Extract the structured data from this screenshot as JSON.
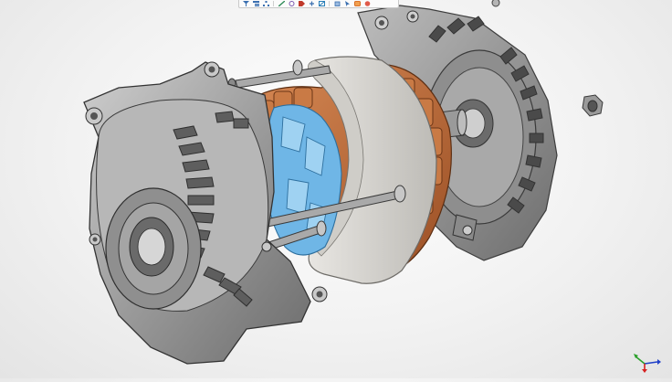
{
  "toolbar": {
    "buttons": [
      {
        "icon": "filter-icon",
        "color": "#3a6fb0"
      },
      {
        "icon": "tree-view-icon",
        "color": "#3a6fb0"
      },
      {
        "icon": "hierarchy-icon",
        "color": "#3a6fb0"
      },
      {
        "icon": "measure-icon",
        "color": "#2e8b57"
      },
      {
        "icon": "clip-icon",
        "color": "#7a58b0"
      },
      {
        "icon": "tag-icon",
        "color": "#c0392b"
      },
      {
        "icon": "explode-icon",
        "color": "#3a6fb0"
      },
      {
        "icon": "section-icon",
        "color": "#2a7fb8"
      },
      {
        "icon": "view-cube-icon",
        "color": "#3a6fb0"
      },
      {
        "icon": "select-icon",
        "color": "#3a6fb0"
      },
      {
        "icon": "display-mode-icon",
        "color": "#d35400"
      },
      {
        "icon": "shaded-sphere-icon",
        "color": "#c0392b"
      }
    ]
  },
  "model": {
    "colors": {
      "housing": "#9a9a9a",
      "housing_dark": "#555555",
      "stator_core": "#d9d7d2",
      "winding": "#b9693a",
      "rotor": "#6fb6e6",
      "shaft": "#8c8c8c"
    }
  },
  "triad": {
    "axes": [
      {
        "axis": "x",
        "color": "#d62020"
      },
      {
        "axis": "y",
        "color": "#2aa02a"
      },
      {
        "axis": "z",
        "color": "#2040c8"
      }
    ]
  }
}
